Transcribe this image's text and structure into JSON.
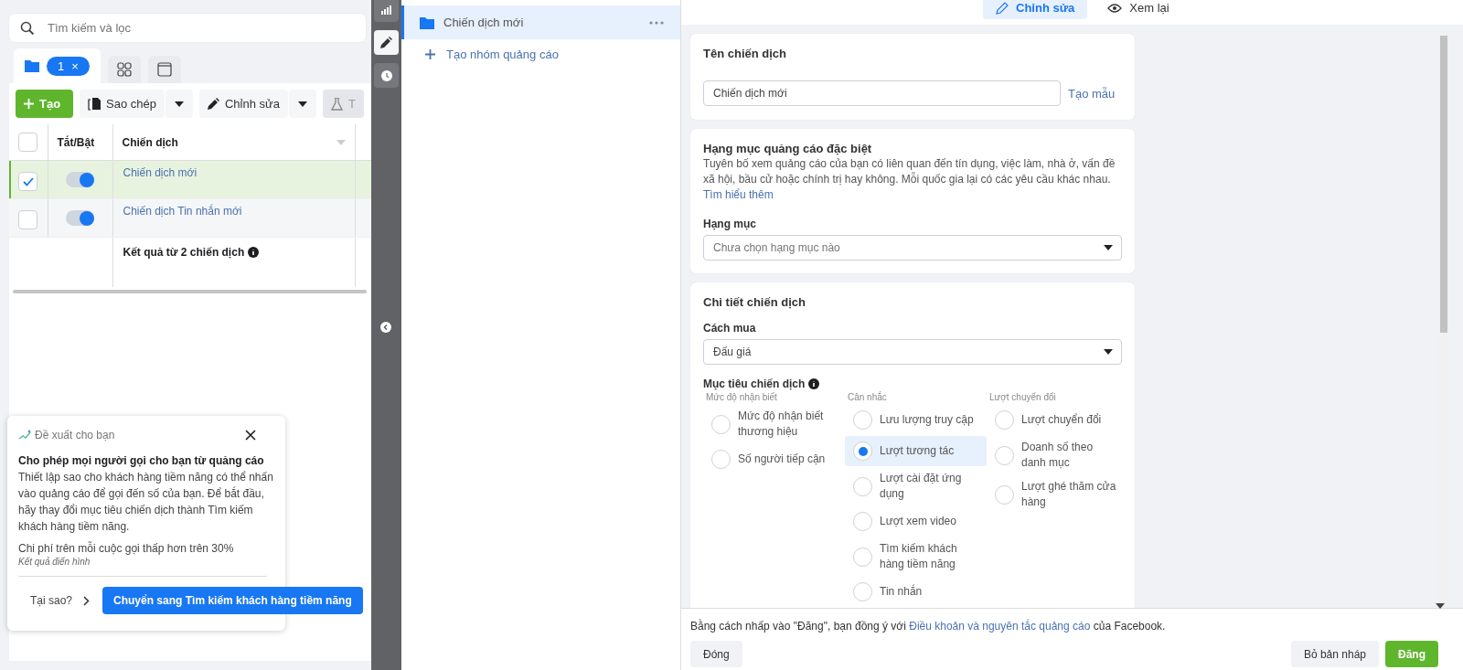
{
  "left_panel": {
    "search": {
      "placeholder": "Tìm kiếm và lọc"
    },
    "filter_tabs": [
      {
        "kind": "folder",
        "badge": "1",
        "badge_close": "×",
        "selected": true
      },
      {
        "kind": "grid",
        "selected": false
      },
      {
        "kind": "window",
        "selected": false
      }
    ],
    "toolbar": [
      {
        "kind": "create",
        "label": "Tạo"
      },
      {
        "kind": "copy",
        "label": "Sao chép"
      },
      {
        "kind": "edit",
        "label": "Chỉnh sửa"
      },
      {
        "kind": "test",
        "label": "T"
      }
    ],
    "table": {
      "columns": [
        "Tắt/Bật",
        "Chiến dịch"
      ],
      "header_checked": false,
      "rows": [
        {
          "name": "Chiến dịch mới",
          "selected": true,
          "on": true
        },
        {
          "name": "Chiến dịch Tin nhắn mới",
          "selected": false,
          "on": true
        }
      ],
      "summary": "Kết quả từ 2 chiến dịch"
    },
    "suggestion": {
      "eyebrow": "Đề xuất cho bạn",
      "title": "Cho phép mọi người gọi cho bạn từ quảng cáo",
      "body": "Thiết lập sao cho khách hàng tiềm năng có thể nhấn vào quảng cáo để gọi đến số của bạn. Để bắt đầu, hãy thay đổi mục tiêu chiến dịch thành Tìm kiếm khách hàng tiềm năng.",
      "stat": "Chi phí trên mỗi cuộc gọi thấp hơn trên 30%",
      "note": "Kết quả điển hình",
      "why": "Tại sao?",
      "action": "Chuyển sang Tìm kiếm khách hàng tiềm năng"
    }
  },
  "tool_strip": [
    {
      "kind": "chart",
      "selected": false
    },
    {
      "kind": "edit",
      "selected": true
    },
    {
      "kind": "history",
      "selected": false
    }
  ],
  "tree": {
    "items": [
      {
        "label": "Chiến dịch mới",
        "selected": true
      }
    ],
    "add": "Tạo nhóm quảng cáo"
  },
  "editor": {
    "tabs": [
      {
        "kind": "edit",
        "label": "Chỉnh sửa",
        "selected": true
      },
      {
        "kind": "review",
        "label": "Xem lại",
        "selected": false
      }
    ],
    "name_card": {
      "title": "Tên chiến dịch",
      "value": "Chiến dịch mới",
      "link": "Tạo mẫu"
    },
    "special_card": {
      "title": "Hạng mục quảng cáo đặc biệt",
      "description": "Tuyên bố xem quảng cáo của bạn có liên quan đến tín dụng, việc làm, nhà ở, vấn đề xã hội, bầu cử hoặc chính trị hay không. Mỗi quốc gia lại có các yêu cầu khác nhau.",
      "link": "Tìm hiểu thêm",
      "field_label": "Hạng mục",
      "placeholder": "Chưa chọn hạng mục nào"
    },
    "details_card": {
      "title": "Chi tiết chiến dịch",
      "buying_label": "Cách mua",
      "buying_value": "Đấu giá",
      "objective_label": "Mục tiêu chiến dịch",
      "objective_groups": [
        {
          "heading": "Mức độ nhận biết",
          "options": [
            {
              "label": "Mức độ nhận biết thương hiệu",
              "selected": false
            },
            {
              "label": "Số người tiếp cận",
              "selected": false
            }
          ]
        },
        {
          "heading": "Cân nhắc",
          "options": [
            {
              "label": "Lưu lượng truy cập",
              "selected": false
            },
            {
              "label": "Lượt tương tác",
              "selected": true
            },
            {
              "label": "Lượt cài đặt ứng dụng",
              "selected": false
            },
            {
              "label": "Lượt xem video",
              "selected": false
            },
            {
              "label": "Tìm kiếm khách hàng tiềm năng",
              "selected": false
            },
            {
              "label": "Tin nhắn",
              "selected": false
            }
          ]
        },
        {
          "heading": "Lượt chuyển đổi",
          "options": [
            {
              "label": "Lượt chuyển đổi",
              "selected": false
            },
            {
              "label": "Doanh số theo danh mục",
              "selected": false
            },
            {
              "label": "Lượt ghé thăm cửa hàng",
              "selected": false
            }
          ]
        }
      ]
    }
  },
  "footer": {
    "notice": "Bằng cách nhấp vào \"Đăng\", bạn đồng ý với ",
    "notice_link": "Điều khoản và nguyên tắc quảng cáo",
    "notice_end": " của Facebook.",
    "close": "Đóng",
    "discard": "Bỏ bản nháp",
    "publish": "Đăng"
  }
}
